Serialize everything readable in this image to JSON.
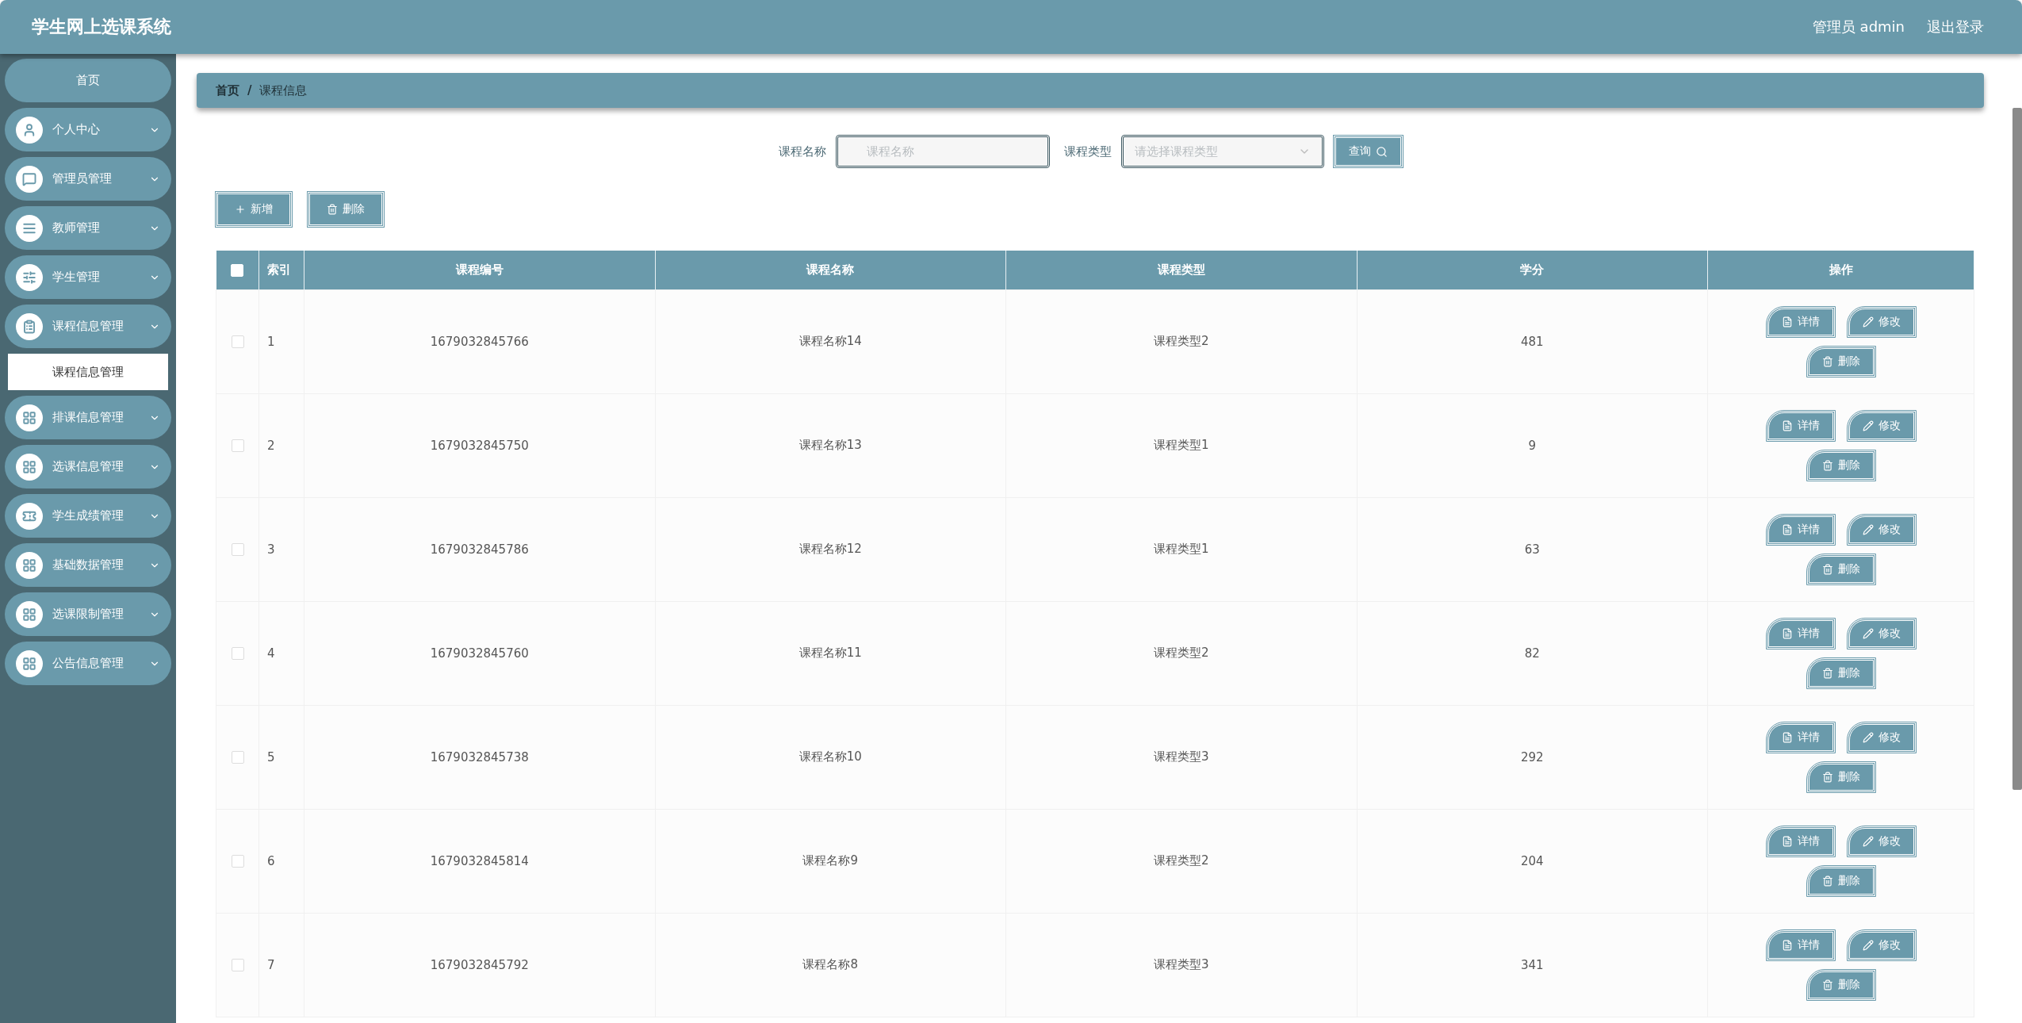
{
  "header": {
    "title": "学生网上选课系统",
    "user": "管理员 admin",
    "logout": "退出登录"
  },
  "sidebar": {
    "items": [
      {
        "label": "首页",
        "kind": "plain"
      },
      {
        "label": "个人中心",
        "kind": "menu"
      },
      {
        "label": "管理员管理",
        "kind": "menu"
      },
      {
        "label": "教师管理",
        "kind": "menu"
      },
      {
        "label": "学生管理",
        "kind": "menu"
      },
      {
        "label": "课程信息管理",
        "kind": "menu",
        "children": [
          {
            "label": "课程信息管理",
            "selected": true
          }
        ]
      },
      {
        "label": "排课信息管理",
        "kind": "menu"
      },
      {
        "label": "选课信息管理",
        "kind": "menu"
      },
      {
        "label": "学生成绩管理",
        "kind": "menu"
      },
      {
        "label": "基础数据管理",
        "kind": "menu"
      },
      {
        "label": "选课限制管理",
        "kind": "menu"
      },
      {
        "label": "公告信息管理",
        "kind": "menu"
      }
    ]
  },
  "breadcrumb": [
    "首页",
    "/",
    "课程信息"
  ],
  "search": {
    "name_label": "课程名称",
    "name_placeholder": "课程名称",
    "type_label": "课程类型",
    "type_placeholder": "请选择课程类型",
    "query_button": "查询"
  },
  "actions": {
    "add": "新增",
    "delete": "删除"
  },
  "table": {
    "header_checked": false,
    "columns": [
      "索引",
      "课程编号",
      "课程名称",
      "课程类型",
      "学分",
      "操作"
    ],
    "rows": [
      {
        "checked": false,
        "cells": [
          "1",
          "1679032845766",
          "课程名称14",
          "课程类型2",
          "481"
        ],
        "buttons": [
          "详情",
          "修改",
          "删除"
        ]
      },
      {
        "checked": false,
        "cells": [
          "2",
          "1679032845750",
          "课程名称13",
          "课程类型1",
          "9"
        ],
        "buttons": [
          "详情",
          "修改",
          "删除"
        ]
      },
      {
        "checked": false,
        "cells": [
          "3",
          "1679032845786",
          "课程名称12",
          "课程类型1",
          "63"
        ],
        "buttons": [
          "详情",
          "修改",
          "删除"
        ]
      },
      {
        "checked": false,
        "cells": [
          "4",
          "1679032845760",
          "课程名称11",
          "课程类型2",
          "82"
        ],
        "buttons": [
          "详情",
          "修改",
          "删除"
        ]
      },
      {
        "checked": false,
        "cells": [
          "5",
          "1679032845738",
          "课程名称10",
          "课程类型3",
          "292"
        ],
        "buttons": [
          "详情",
          "修改",
          "删除"
        ]
      },
      {
        "checked": false,
        "cells": [
          "6",
          "1679032845814",
          "课程名称9",
          "课程类型2",
          "204"
        ],
        "buttons": [
          "详情",
          "修改",
          "删除"
        ]
      },
      {
        "checked": false,
        "cells": [
          "7",
          "1679032845792",
          "课程名称8",
          "课程类型3",
          "341"
        ],
        "buttons": [
          "详情",
          "修改",
          "删除"
        ]
      }
    ]
  }
}
